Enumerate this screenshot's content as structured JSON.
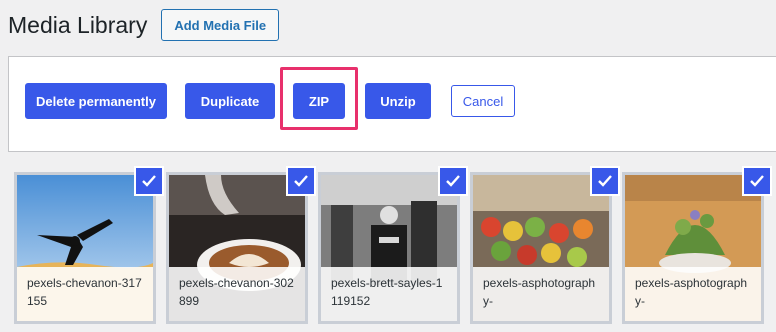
{
  "header": {
    "title": "Media Library",
    "add_button": "Add Media File"
  },
  "toolbar": {
    "delete_permanently": "Delete permanently",
    "duplicate": "Duplicate",
    "zip": "ZIP",
    "unzip": "Unzip",
    "cancel": "Cancel"
  },
  "colors": {
    "primary": "#3858e9",
    "highlight": "#e8306c"
  },
  "media": [
    {
      "label": "pexels-chevanon-317155",
      "selected": true,
      "icon": "check-icon"
    },
    {
      "label": "pexels-chevanon-302899",
      "selected": true,
      "icon": "check-icon"
    },
    {
      "label": "pexels-brett-sayles-1119152",
      "selected": true,
      "icon": "check-icon"
    },
    {
      "label": "pexels-asphotography-",
      "selected": true,
      "icon": "check-icon"
    },
    {
      "label": "pexels-asphotography-",
      "selected": true,
      "icon": "check-icon"
    }
  ]
}
